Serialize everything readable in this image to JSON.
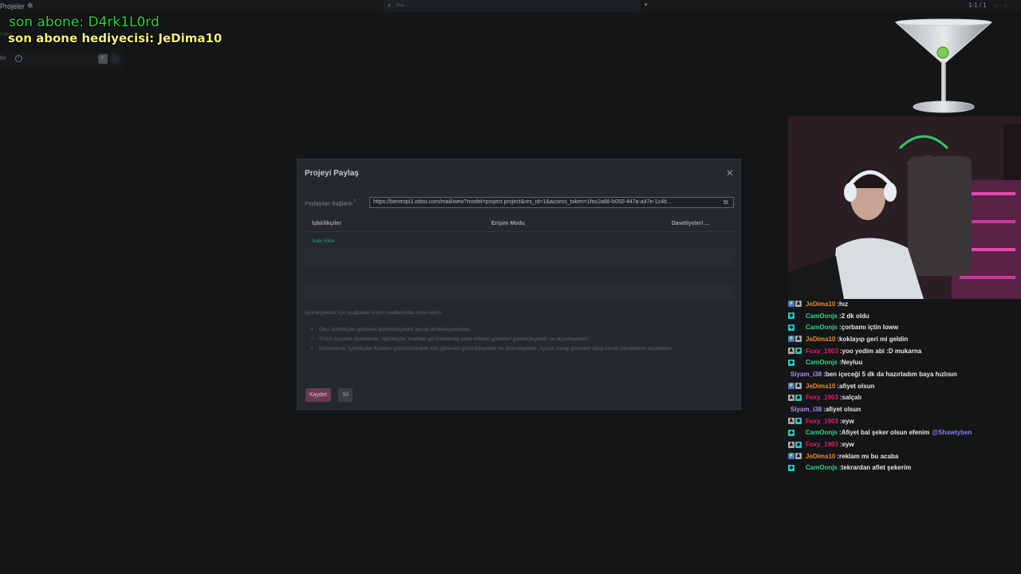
{
  "app": {
    "title": "Projeler",
    "search_placeholder": "Ara...",
    "pager": "1-1 / 1",
    "sidebar_label": "fer",
    "side_partial": "i Veri"
  },
  "stream_overlay": {
    "last_sub": "son abone: D4rk1L0rd",
    "last_gift": "son abone hediyecisi: JeDima10"
  },
  "modal": {
    "title": "Projeyi Paylaş",
    "link_label": "Paylaşılan Bağlantı",
    "link_value": "https://bentropi1.odoo.com/mail/view?model=project.project&res_id=1&access_token=1fec2a88-b050-447a-a47e-1c4b...",
    "columns": [
      "İşbirlikçiler",
      "Erişim Modu",
      "Davetiyeleri ..."
    ],
    "add_row": "Satır Ekle",
    "help_intro": "İşbirlikçileriniz için aşağıdaki erişim modlarından birini seçin:",
    "help_items": [
      "Oku: İşbirlikçiler görevleri görüntüleyebilir ancak düzenleyemezler.",
      "Sınırlı erişimle düzenleme: İşbirlikçiler, Kanban görünümünde takip ettikleri görevleri görüntüleyebilir ve düzenleyebilir.",
      "Düzenleme: İşbirlikçiler Kanban görünümündeki tüm görevleri görüntüleyebilir ve düzenleyebilir. Ayrıca, hangi görevleri takip etmek istediklerini seçebilirler."
    ],
    "save_label": "Kaydet",
    "delete_label": "Sil"
  },
  "chat": [
    {
      "user": "JeDima10",
      "color": "#f08a2b",
      "badges": [
        "blue",
        "gray"
      ],
      "message": "hız"
    },
    {
      "user": "CamOonjs",
      "color": "#33d68a",
      "badges": [
        "teal"
      ],
      "message": "2 dk oldu"
    },
    {
      "user": "CamOonjs",
      "color": "#33d68a",
      "badges": [
        "teal"
      ],
      "message": "çorbamı içtin loww"
    },
    {
      "user": "JeDima10",
      "color": "#f08a2b",
      "badges": [
        "blue",
        "gray"
      ],
      "message": "koklayıp geri mi geldin"
    },
    {
      "user": "Foxy_1903",
      "color": "#e0206a",
      "badges": [
        "gray",
        "teal"
      ],
      "message": "yoo yedim abi :D mukarna"
    },
    {
      "user": "CamOonjs",
      "color": "#33d68a",
      "badges": [
        "teal"
      ],
      "message": "Neyluu"
    },
    {
      "user": "Siyam_i38",
      "color": "#b48cf0",
      "badges": [],
      "message": "ben içeceği 5 dk da hazırladım baya hızlısın"
    },
    {
      "user": "JeDima10",
      "color": "#f08a2b",
      "badges": [
        "blue",
        "gray"
      ],
      "message": "afiyet olsun"
    },
    {
      "user": "Foxy_1903",
      "color": "#e0206a",
      "badges": [
        "gray",
        "teal"
      ],
      "message": "salçalı"
    },
    {
      "user": "Siyam_i38",
      "color": "#b48cf0",
      "badges": [],
      "message": "afiyet olsun"
    },
    {
      "user": "Foxy_1903",
      "color": "#e0206a",
      "badges": [
        "gray",
        "teal"
      ],
      "message": "eyw"
    },
    {
      "user": "CamOonjs",
      "color": "#33d68a",
      "badges": [
        "teal"
      ],
      "message": "Afiyet bal şeker olsun efenim",
      "mention": "@Shawtyben"
    },
    {
      "user": "Foxy_1903",
      "color": "#e0206a",
      "badges": [
        "gray",
        "teal"
      ],
      "message": "eyw"
    },
    {
      "user": "JeDima10",
      "color": "#f08a2b",
      "badges": [
        "blue",
        "gray"
      ],
      "message": "reklam mı bu acaba"
    },
    {
      "user": "CamOonjs",
      "color": "#33d68a",
      "badges": [
        "teal"
      ],
      "message": "tekrardan afiet şekerim"
    }
  ]
}
